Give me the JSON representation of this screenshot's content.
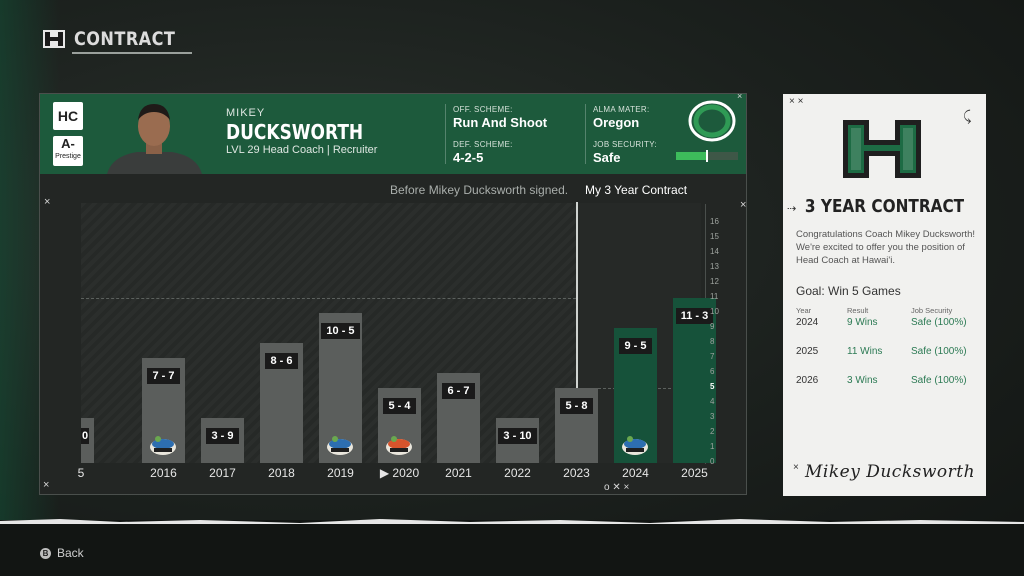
{
  "header": {
    "title": "CONTRACT",
    "logo_icon": "hawaii-h-logo-icon"
  },
  "coach": {
    "role_badge": "HC",
    "prestige_grade": "A-",
    "prestige_label": "Prestige",
    "first_name": "MIKEY",
    "last_name": "DUCKSWORTH",
    "subtitle": "LVL 29 Head Coach | Recruiter",
    "off_scheme_label": "OFF. SCHEME:",
    "off_scheme": "Run And Shoot",
    "def_scheme_label": "DEF. SCHEME:",
    "def_scheme": "4-2-5",
    "alma_mater_label": "ALMA MATER:",
    "alma_mater": "Oregon",
    "job_security_label": "JOB SECURITY:",
    "job_security": "Safe",
    "job_security_level": 0.5,
    "alma_mater_logo_icon": "oregon-o-logo-icon",
    "colors": {
      "banner": "#1d5a3c",
      "meter": "#3dbb5b"
    }
  },
  "chart_data": {
    "type": "bar",
    "legend": {
      "before": "Before Mikey Ducksworth signed.",
      "contract": "My 3 Year Contract"
    },
    "categories": [
      "5",
      "2016",
      "2017",
      "2018",
      "2019",
      "2020",
      "2021",
      "2022",
      "2023",
      "2024",
      "2025"
    ],
    "records": [
      "0",
      "7 - 7",
      "3 - 9",
      "8 - 6",
      "10 - 5",
      "5 - 4",
      "6 - 7",
      "3 - 10",
      "5 - 8",
      "9 - 5",
      "11 - 3"
    ],
    "wins": [
      3,
      7,
      3,
      8,
      10,
      5,
      6,
      3,
      5,
      9,
      11
    ],
    "contract_years": [
      "2024",
      "2025"
    ],
    "current_year_marker": "2020",
    "bowl_icons": {
      "2016": "bowl-trophy-icon",
      "2019": "bowl-trophy-icon",
      "2020": "bowl-trophy-icon",
      "2024": "bowl-trophy-icon"
    },
    "y_ticks": [
      "0",
      "1",
      "2",
      "3",
      "4",
      "5",
      "6",
      "7",
      "8",
      "9",
      "10",
      "11",
      "12",
      "13",
      "14",
      "15",
      "16"
    ],
    "goal_line": 5,
    "reference_line": 11,
    "ylim": [
      0,
      16
    ],
    "colors": {
      "past_bar": "#5b5e5c",
      "contract_bar": "#16523a"
    }
  },
  "contract_card": {
    "logo_icon": "hawaii-h-logo-icon",
    "title": "3 YEAR CONTRACT",
    "message": "Congratulations Coach Mikey Ducksworth! We're excited to offer you the position of Head Coach at Hawai'i.",
    "goal": "Goal: Win 5 Games",
    "headers": [
      "Year",
      "Result",
      "Job Security"
    ],
    "rows": [
      {
        "year": "2024",
        "result": "9 Wins",
        "security": "Safe (100%)"
      },
      {
        "year": "2025",
        "result": "11 Wins",
        "security": "Safe (100%)"
      },
      {
        "year": "2026",
        "result": "3 Wins",
        "security": "Safe (100%)"
      }
    ],
    "signature": "Mikey Ducksworth"
  },
  "footer": {
    "back_button_glyph": "B",
    "back_label": "Back"
  }
}
